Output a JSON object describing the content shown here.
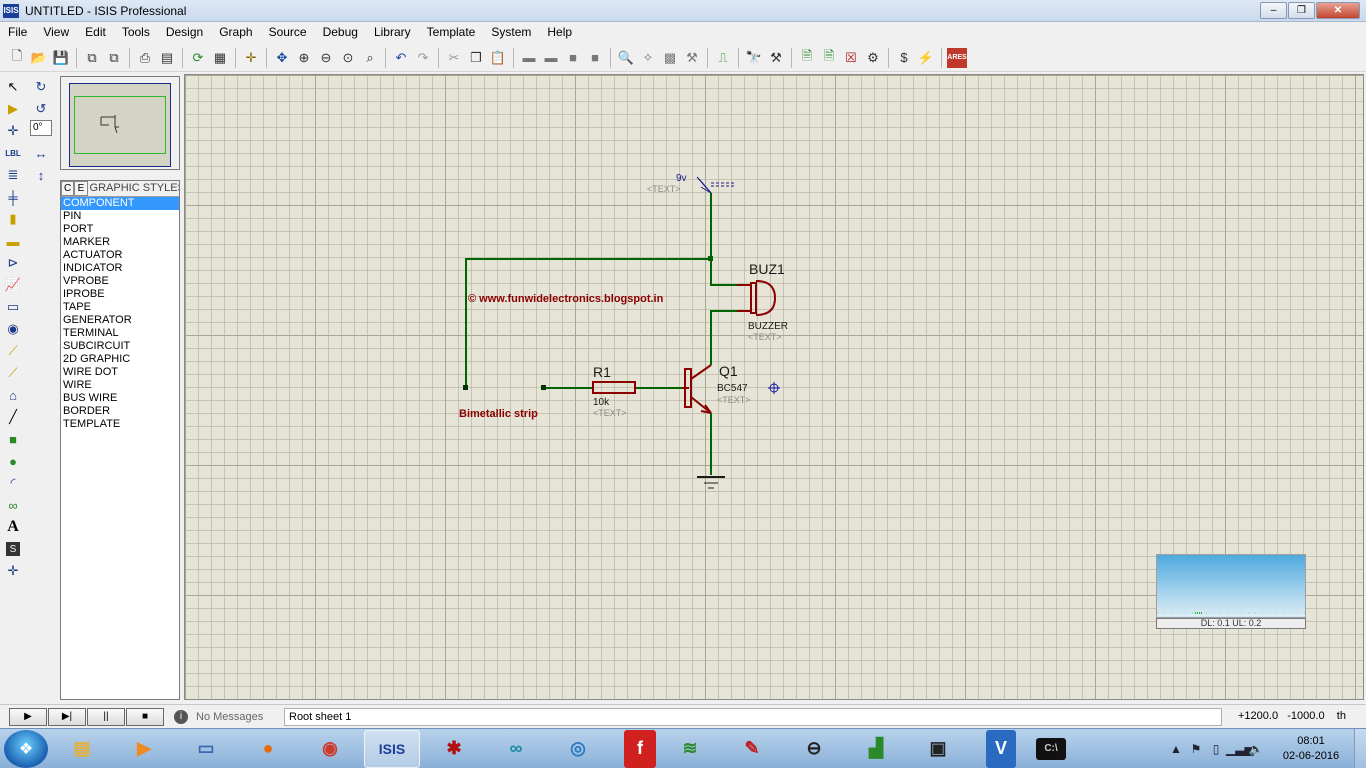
{
  "window": {
    "app_icon_text": "ISIS",
    "title": "UNTITLED - ISIS Professional",
    "buttons": [
      "–",
      "❐",
      "✕"
    ]
  },
  "menu": [
    "File",
    "View",
    "Edit",
    "Tools",
    "Design",
    "Graph",
    "Source",
    "Debug",
    "Library",
    "Template",
    "System",
    "Help"
  ],
  "toolbar_icons": [
    "new-icon",
    "open-icon",
    "save-icon",
    "import-icon",
    "export-icon",
    "print-icon",
    "print-area-icon",
    "redraw-icon",
    "grid-icon",
    "origin-icon",
    "pan-icon",
    "zoom-in-icon",
    "zoom-out-icon",
    "zoom-all-icon",
    "zoom-area-icon",
    "undo-icon",
    "redo-icon",
    "cut-icon",
    "copy-icon",
    "paste-icon",
    "block-copy-icon",
    "block-move-icon",
    "block-rotate-icon",
    "block-delete-icon",
    "pick-device-icon",
    "make-device-icon",
    "packaging-icon",
    "decompose-icon",
    "wire-autorouter-icon",
    "search-tag-icon",
    "property-assign-icon",
    "new-sheet-icon",
    "remove-sheet-icon",
    "exit-to-parent-icon",
    "bill-of-materials-icon",
    "electrical-rule-check-icon",
    "netlist-to-ares-icon"
  ],
  "rotation": {
    "value": "0°"
  },
  "selector": {
    "tabs": [
      "C",
      "E"
    ],
    "title": "GRAPHIC STYLES",
    "items": [
      "COMPONENT",
      "PIN",
      "PORT",
      "MARKER",
      "ACTUATOR",
      "INDICATOR",
      "VPROBE",
      "IPROBE",
      "TAPE",
      "GENERATOR",
      "TERMINAL",
      "SUBCIRCUIT",
      "2D GRAPHIC",
      "WIRE DOT",
      "WIRE",
      "BUS WIRE",
      "BORDER",
      "TEMPLATE"
    ],
    "selected_index": 0
  },
  "schematic": {
    "power_label": "9v",
    "power_text": "<TEXT>",
    "buzzer": {
      "ref": "BUZ1",
      "value": "BUZZER",
      "text": "<TEXT>"
    },
    "resistor": {
      "ref": "R1",
      "value": "10k",
      "text": "<TEXT>"
    },
    "transistor": {
      "ref": "Q1",
      "value": "BC547",
      "text": "<TEXT>"
    },
    "watermark": "© www.funwidelectronics.blogspot.in",
    "strip_label": "Bimetallic strip",
    "colors": {
      "wire": "#006400",
      "component": "#8b0000",
      "label_blue": "#1a1a8a",
      "text_grey": "#8a8a8a"
    }
  },
  "sim_widget": {
    "label": "DL: 0.1 UL: 0.2"
  },
  "status": {
    "sim_buttons": [
      "▶",
      "▶|",
      "||",
      "■"
    ],
    "message": "No Messages",
    "sheet": "Root sheet 1",
    "coord_x": "+1200.0",
    "coord_y": "-1000.0",
    "unit": "th"
  },
  "taskbar": {
    "apps": [
      "explorer",
      "media-player",
      "remote-desktop",
      "firefox",
      "chrome",
      "isis",
      "ladybug",
      "arduino",
      "network",
      "foxit",
      "eagle",
      "pen-tool",
      "app-record",
      "graph-tool",
      "chip",
      "vivado",
      "cmd"
    ],
    "clock_time": "08:01",
    "clock_date": "02-06-2016"
  }
}
